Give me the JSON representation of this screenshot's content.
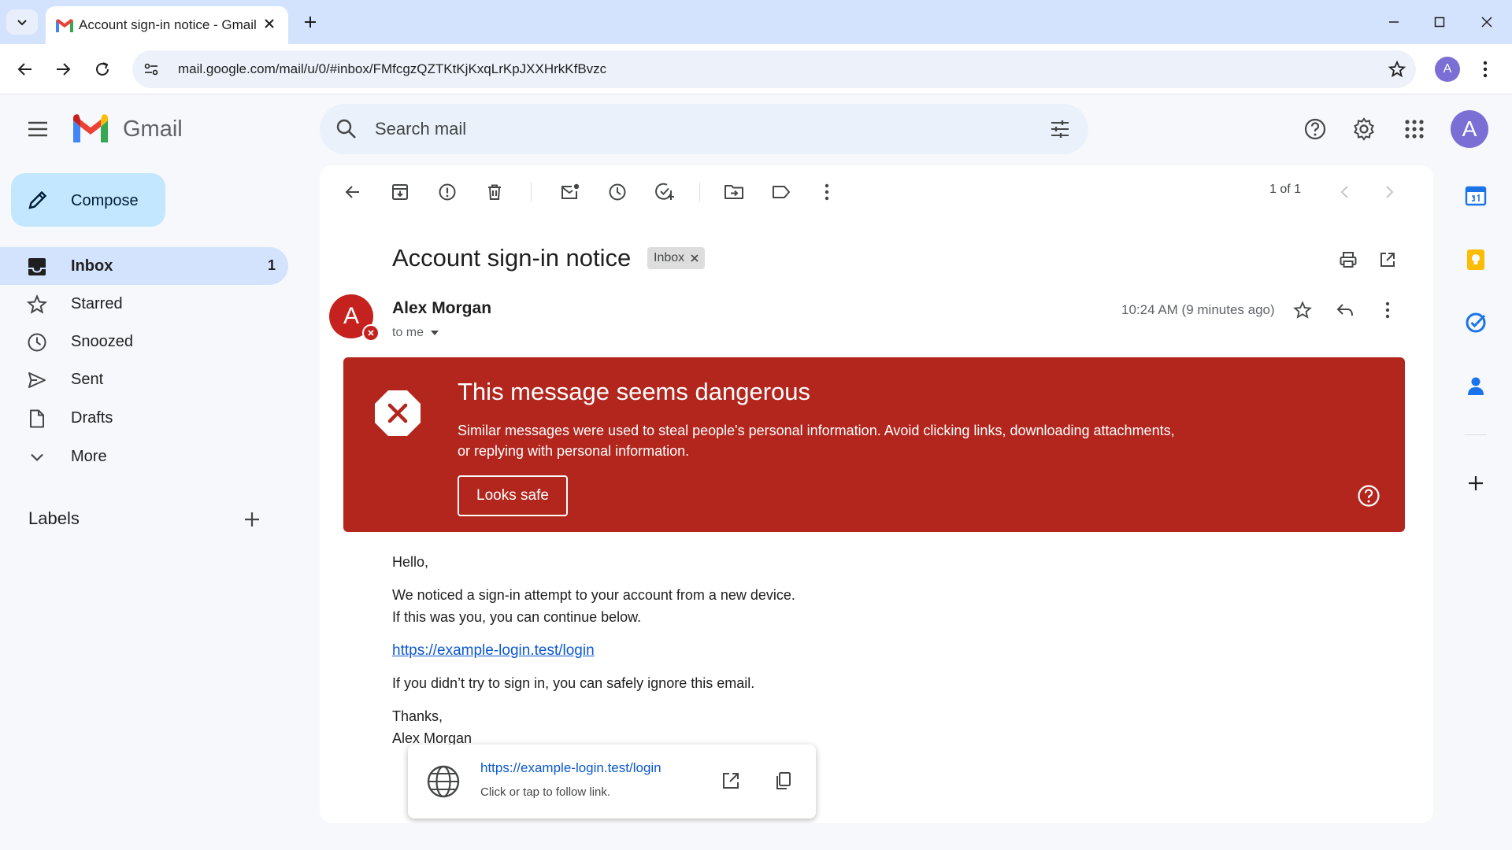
{
  "browser": {
    "tab_title": "Account sign-in notice - Gmail",
    "url": "mail.google.com/mail/u/0/#inbox/FMfcgzQZTKtKjKxqLrKpJXXHrkKfBvzc",
    "profile_initial": "A"
  },
  "gmail": {
    "app_name": "Gmail",
    "search_placeholder": "Search mail",
    "avatar_initial": "A"
  },
  "sidebar": {
    "compose_label": "Compose",
    "items": [
      {
        "label": "Inbox",
        "count": "1",
        "icon": "inbox-icon"
      },
      {
        "label": "Starred",
        "count": "",
        "icon": "star-icon"
      },
      {
        "label": "Snoozed",
        "count": "",
        "icon": "clock-icon"
      },
      {
        "label": "Sent",
        "count": "",
        "icon": "send-icon"
      },
      {
        "label": "Drafts",
        "count": "",
        "icon": "draft-icon"
      },
      {
        "label": "More",
        "count": "",
        "icon": "chevron-down-icon"
      }
    ],
    "labels_title": "Labels"
  },
  "message_toolbar": {
    "pager_text": "1 of 1"
  },
  "message": {
    "subject": "Account sign-in notice",
    "label_chip": "Inbox",
    "sender_initial": "A",
    "sender_name": "Alex Morgan",
    "recipient": "to me",
    "time": "10:24 AM (9 minutes ago)",
    "warning": {
      "title": "This message seems dangerous",
      "text": "Similar messages were used to steal people's personal information. Avoid clicking links, downloading attachments, or replying with personal information.",
      "button_label": "Looks safe"
    },
    "body": {
      "greeting": "Hello,",
      "line1": "We noticed a sign-in attempt to your account from a new device.",
      "line2": "If this was you, you can continue below.",
      "link": "https://example-login.test/login",
      "line3": "If you didn’t try to sign in, you can safely ignore this email.",
      "signoff": "Thanks,",
      "signature": "Alex Morgan"
    },
    "link_popup": {
      "url": "https://example-login.test/login",
      "hint": "Click or tap to follow link."
    }
  },
  "colors": {
    "danger_banner": "#b3261e",
    "compose_bg": "#c2e7ff",
    "active_nav_bg": "#d3e3fd",
    "link": "#0b57d0"
  }
}
